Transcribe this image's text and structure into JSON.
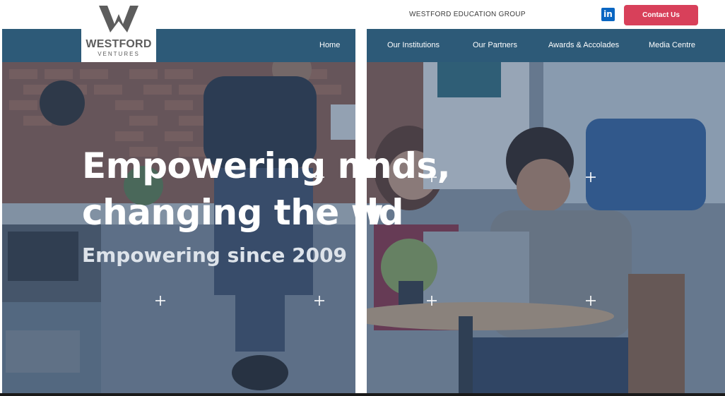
{
  "header": {
    "group_name": "WESTFORD EDUCATION GROUP",
    "linkedin_label": "in",
    "contact_label": "Contact Us"
  },
  "logo": {
    "name": "WESTFORD",
    "sub": "VENTURES"
  },
  "nav": {
    "items": [
      {
        "label": "Home"
      },
      {
        "label": "Our Institutions"
      },
      {
        "label": "Our Partners"
      },
      {
        "label": "Awards & Accolades"
      },
      {
        "label": "Media Centre"
      }
    ]
  },
  "hero": {
    "line1_left": "Empowering m",
    "line1_right": "nds,",
    "line2_left": "changing the w",
    "line2_right": "ld",
    "subtitle": "Empowering since 2009"
  },
  "colors": {
    "nav_bg": "#2d5a78",
    "contact_bg": "#d8405a",
    "linkedin": "#0a66c2"
  },
  "icons": [
    "linkedin-icon",
    "westford-logo-icon",
    "crosshair-icon"
  ]
}
